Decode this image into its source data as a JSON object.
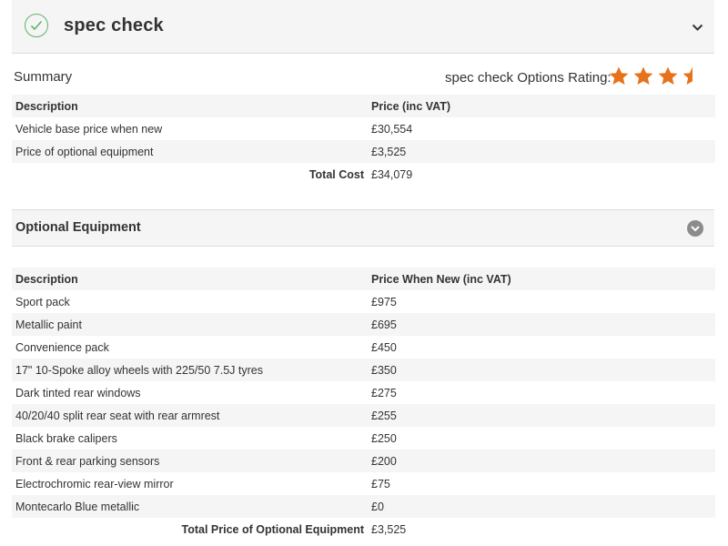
{
  "header": {
    "title": "spec check",
    "check_icon": "check-circle-icon",
    "expand_icon": "chevron-down-icon"
  },
  "summary": {
    "label": "Summary",
    "rating_label": "spec check Options Rating:",
    "rating": 3.5,
    "rating_max": 4,
    "star_color": "#e8711c",
    "columns": [
      "Description",
      "Price (inc VAT)"
    ],
    "rows": [
      [
        "Vehicle base price when new",
        "£30,554"
      ],
      [
        "Price of optional equipment",
        "£3,525"
      ]
    ],
    "total_label": "Total Cost",
    "total_value": "£34,079"
  },
  "optional": {
    "title": "Optional Equipment",
    "columns": [
      "Description",
      "Price When New (inc VAT)"
    ],
    "rows": [
      [
        "Sport pack",
        "£975"
      ],
      [
        "Metallic paint",
        "£695"
      ],
      [
        "Convenience pack",
        "£450"
      ],
      [
        "17\" 10-Spoke alloy wheels with 225/50 7.5J tyres",
        "£350"
      ],
      [
        "Dark tinted rear windows",
        "£275"
      ],
      [
        "40/20/40 split rear seat with rear armrest",
        "£255"
      ],
      [
        "Black brake calipers",
        "£250"
      ],
      [
        "Front & rear parking sensors",
        "£200"
      ],
      [
        "Electrochromic rear-view mirror",
        "£75"
      ],
      [
        "Montecarlo Blue metallic",
        "£0"
      ]
    ],
    "total_label": "Total Price of Optional Equipment",
    "total_value": "£3,525"
  }
}
